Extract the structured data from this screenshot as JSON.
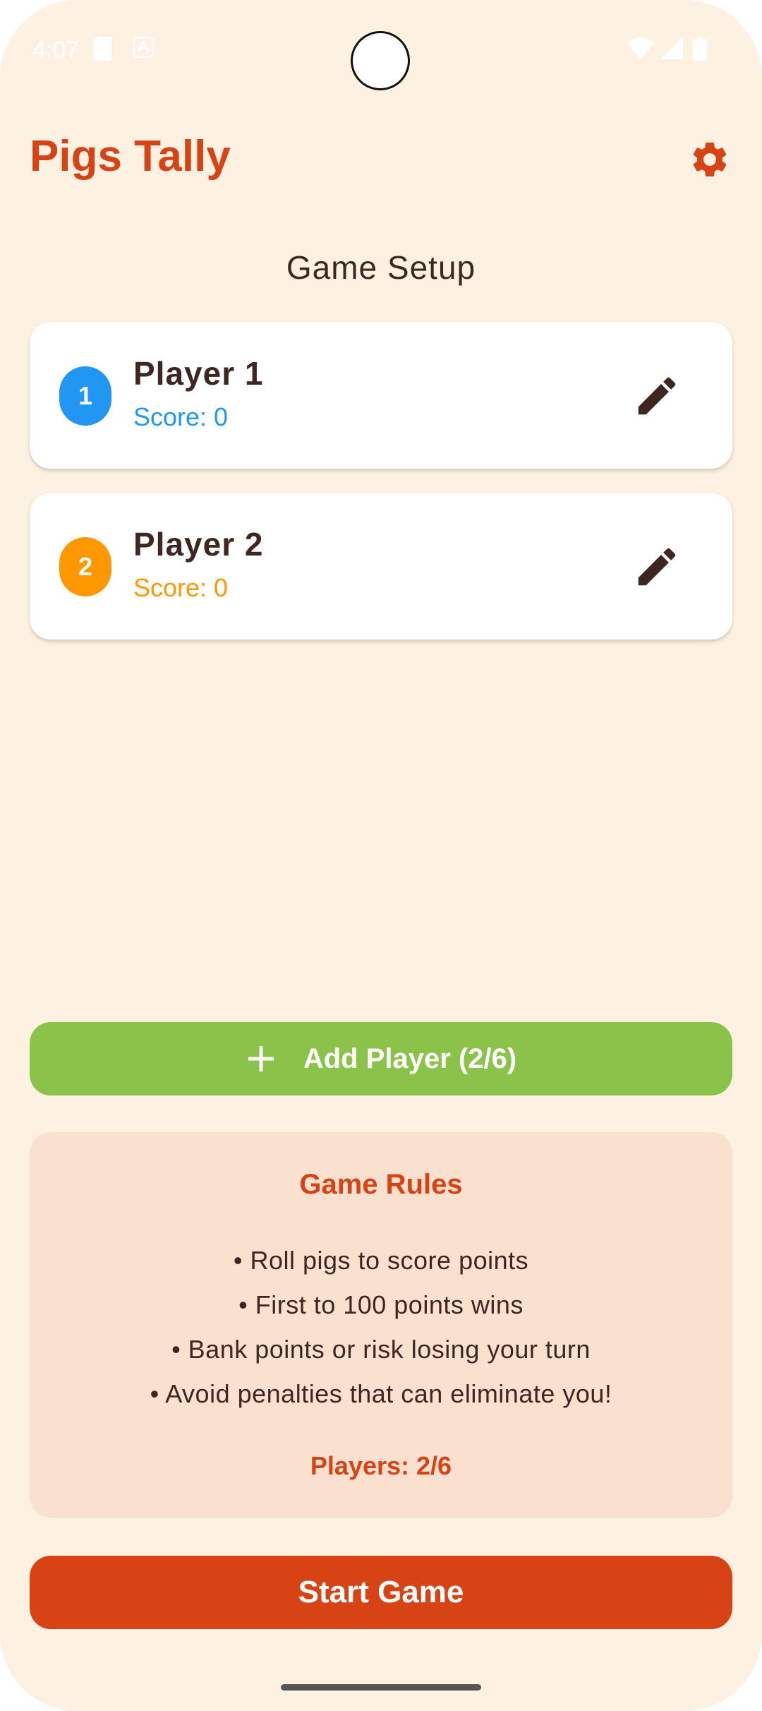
{
  "status_bar": {
    "time": "4:07",
    "icons": [
      "sd-card-icon",
      "autofill-icon",
      "wifi-icon",
      "signal-icon",
      "battery-icon"
    ]
  },
  "app": {
    "title": "Pigs Tally",
    "settings_icon": "settings-gear-icon"
  },
  "setup": {
    "title": "Game Setup"
  },
  "players": [
    {
      "number": "1",
      "name": "Player 1",
      "score_text": "Score: 0",
      "color": "#2196f3",
      "edit_icon": "pencil-icon"
    },
    {
      "number": "2",
      "name": "Player 2",
      "score_text": "Score: 0",
      "color": "#ff9800",
      "edit_icon": "pencil-icon"
    }
  ],
  "add_player": {
    "label": "Add Player (2/6)",
    "icon": "plus-icon",
    "color": "#8bc34a"
  },
  "rules": {
    "title": "Game Rules",
    "items": [
      "• Roll pigs to score points",
      "• First to 100 points wins",
      "• Bank points or risk losing your turn",
      "• Avoid penalties that can eliminate you!"
    ],
    "players_count": "Players: 2/6"
  },
  "start": {
    "label": "Start Game",
    "color": "#d84315"
  }
}
